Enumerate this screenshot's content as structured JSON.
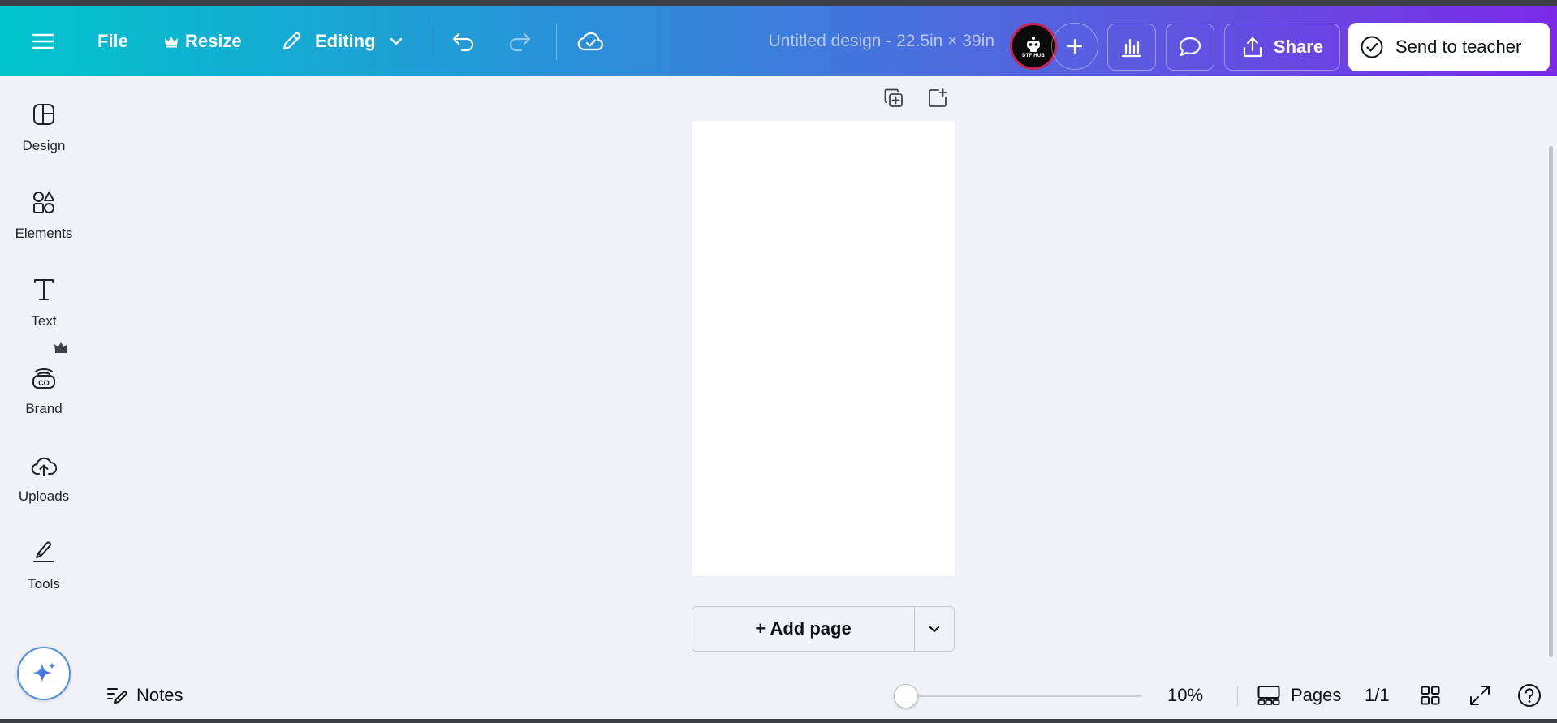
{
  "topbar": {
    "file_label": "File",
    "resize_label": "Resize",
    "editing_label": "Editing",
    "document_title": "Untitled design - 22.5in × 39in",
    "avatar_text": "DTF HUB",
    "share_label": "Share",
    "send_to_teacher_label": "Send to teacher"
  },
  "sidebar": {
    "items": [
      {
        "label": "Design",
        "icon": "design-icon"
      },
      {
        "label": "Elements",
        "icon": "elements-icon"
      },
      {
        "label": "Text",
        "icon": "text-icon"
      },
      {
        "label": "Brand",
        "icon": "brand-icon"
      },
      {
        "label": "Uploads",
        "icon": "uploads-icon"
      },
      {
        "label": "Tools",
        "icon": "tools-icon"
      }
    ]
  },
  "canvas": {
    "add_page_label": "+ Add page"
  },
  "bottombar": {
    "notes_label": "Notes",
    "zoom_percent": 10,
    "zoom_label": "10%",
    "pages_label": "Pages",
    "page_count": "1/1"
  },
  "colors": {
    "gradient_start": "#00c4cc",
    "gradient_end": "#7c2ae8",
    "canvas_bg": "#f0f2f7",
    "avatar_ring": "#c72455"
  }
}
